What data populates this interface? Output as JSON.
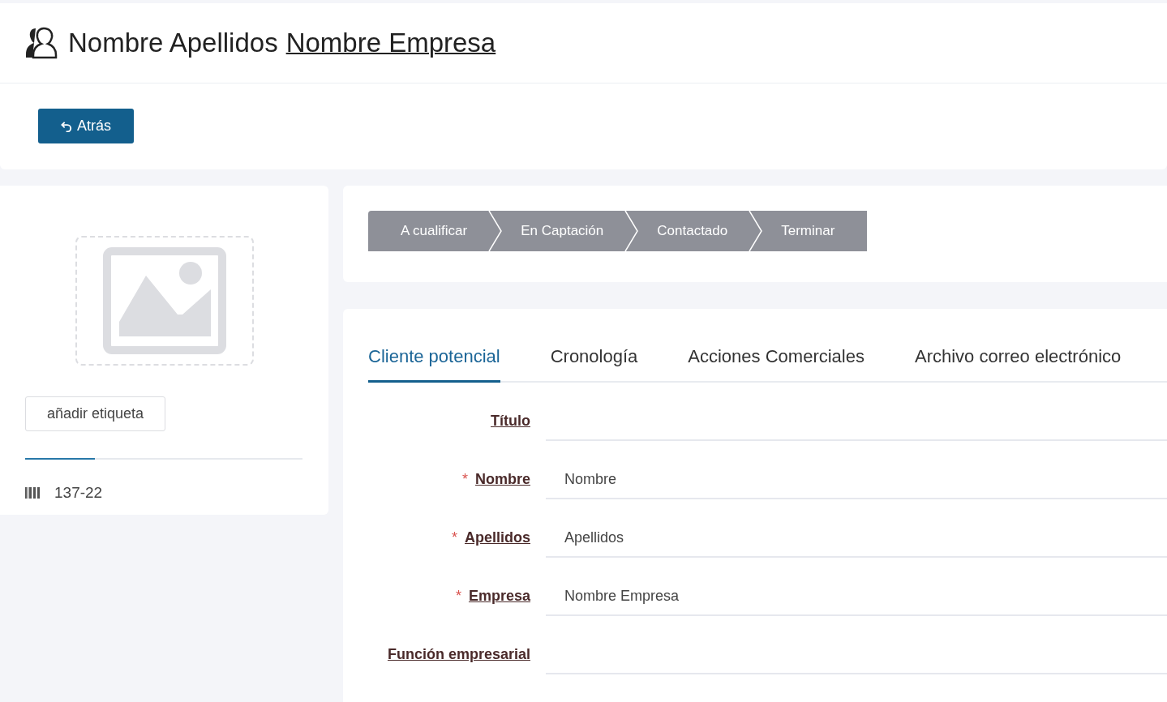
{
  "header": {
    "title": "Nombre Apellidos",
    "company_link": "Nombre Empresa"
  },
  "toolbar": {
    "back_button": "Atrás"
  },
  "profile": {
    "tag_button": "añadir etiqueta",
    "progress": {
      "level": 0.25
    },
    "code": "137-22"
  },
  "stages": [
    {
      "label": "A cualificar"
    },
    {
      "label": "En Captación"
    },
    {
      "label": "Contactado"
    },
    {
      "label": "Terminar"
    }
  ],
  "tabs": [
    {
      "label": "Cliente potencial",
      "selected": true
    },
    {
      "label": "Cronología",
      "selected": false
    },
    {
      "label": "Acciones Comerciales",
      "selected": false
    },
    {
      "label": "Archivo correo electrónico",
      "selected": false
    }
  ],
  "fields": [
    {
      "label": "Título"
    },
    {
      "label": "Nombre",
      "required_mark": "*",
      "value": "Nombre"
    },
    {
      "label": "Apellidos",
      "required_mark": "*",
      "value": "Apellidos"
    },
    {
      "label": "Empresa",
      "required_mark": "*",
      "value": "Nombre Empresa"
    },
    {
      "label": "Función empresarial"
    }
  ]
}
